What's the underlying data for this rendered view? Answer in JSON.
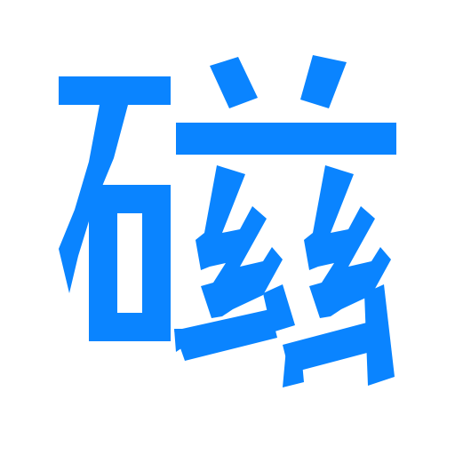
{
  "character": "磁",
  "color": "#0a84ff",
  "background": "#ffffff"
}
